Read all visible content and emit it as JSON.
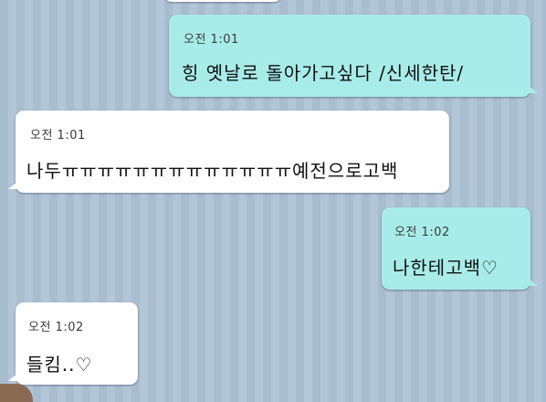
{
  "messages": [
    {
      "direction": "outgoing",
      "time": "오전 1:01",
      "text": "힝 옛날로 돌아가고싶다 /신세한탄/"
    },
    {
      "direction": "incoming",
      "time": "오전 1:01",
      "text": "나두ㅠㅠㅠㅠㅠㅠㅠㅠㅠㅠㅠㅠㅠ예전으로고백"
    },
    {
      "direction": "outgoing",
      "time": "오전 1:02",
      "text": "나한테고백♡"
    },
    {
      "direction": "incoming",
      "time": "오전 1:02",
      "text": "들킴..♡"
    }
  ],
  "colors": {
    "outgoing_bubble": "#a8ece9",
    "incoming_bubble": "#ffffff",
    "background_stripe_a": "#a9bdd0",
    "background_stripe_b": "#b3c6d8"
  }
}
